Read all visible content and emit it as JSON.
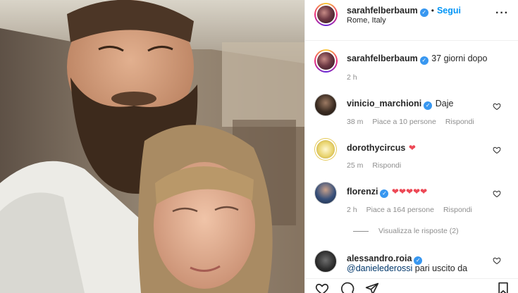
{
  "post": {
    "author": "sarahfelberbaum",
    "follow_label": "Segui",
    "separator": "•",
    "location": "Rome, Italy",
    "more_label": "···"
  },
  "caption": {
    "author": "sarahfelberbaum",
    "text": "37 giorni dopo",
    "time": "2 h"
  },
  "comments": [
    {
      "user": "vinicio_marchioni",
      "verified": true,
      "text": "Daje",
      "time": "38 m",
      "likes": "Piace a 10 persone",
      "reply": "Rispondi"
    },
    {
      "user": "dorothycircus",
      "verified": false,
      "text": "",
      "hearts": "❤",
      "time": "25 m",
      "reply": "Rispondi"
    },
    {
      "user": "florenzi",
      "verified": true,
      "text": "",
      "hearts": "❤❤❤❤❤",
      "time": "2 h",
      "likes": "Piace a 164 persone",
      "reply": "Rispondi",
      "view_replies": "Visualizza le risposte (2)"
    },
    {
      "user": "alessandro.roia",
      "verified": true,
      "mention": "@danielederossi",
      "text": " pari uscito da"
    }
  ],
  "icons": {
    "verified": "verified-badge-icon",
    "heart": "heart-outline-icon",
    "comment": "comment-bubble-icon",
    "share": "paper-plane-icon",
    "save": "bookmark-icon"
  },
  "colors": {
    "accent": "#0095f6",
    "verified": "#3897f0",
    "heart": "#ed4956",
    "muted": "#8e8e8e"
  }
}
